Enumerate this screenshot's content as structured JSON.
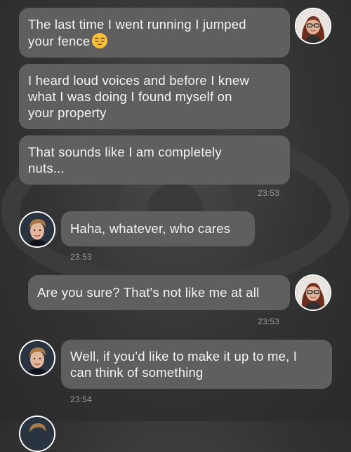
{
  "messages": [
    {
      "sender": "me",
      "lines": [
        "The last time I went running I jumped",
        "your fence"
      ],
      "emoji": "pensive-face-emoji"
    },
    {
      "sender": "me",
      "lines": [
        "I heard loud voices and before I knew",
        "what I was doing I found myself on",
        "your property"
      ]
    },
    {
      "sender": "me",
      "lines": [
        "That sounds like I am completely",
        "nuts..."
      ],
      "time": "23:53"
    },
    {
      "sender": "contact",
      "lines": [
        "Haha, whatever, who cares"
      ],
      "time": "23:53"
    },
    {
      "sender": "me",
      "lines": [
        "Are you sure? That's not like me at all"
      ],
      "time": "23:53"
    },
    {
      "sender": "contact",
      "lines": [
        "Well, if you'd like to make it up to me, I",
        "can think of something"
      ],
      "time": "23:54"
    }
  ],
  "colors": {
    "background": "#333333",
    "bubble": "#5f5f5f",
    "text": "#f4f4f4",
    "timestamp": "#9a9a9a"
  }
}
